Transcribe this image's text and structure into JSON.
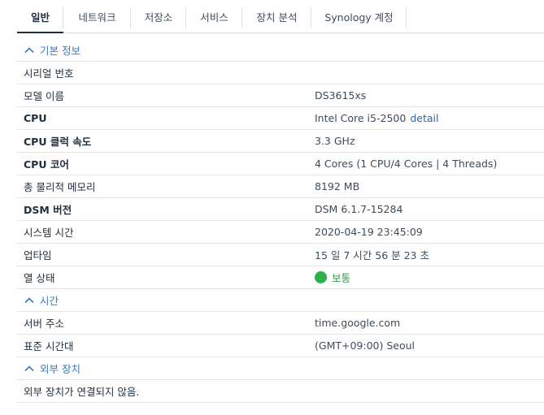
{
  "tabs": [
    {
      "label": "일반",
      "active": true
    },
    {
      "label": "네트워크"
    },
    {
      "label": "저장소"
    },
    {
      "label": "서비스"
    },
    {
      "label": "장치 분석"
    },
    {
      "label": "Synology 계정"
    }
  ],
  "sections": {
    "basic": {
      "title": "기본 정보",
      "rows": [
        {
          "label": "시리얼 번호",
          "value": ""
        },
        {
          "label": "모델 이름",
          "value": "DS3615xs"
        },
        {
          "label": "CPU",
          "value": "Intel Core i5-2500",
          "link": "detail"
        },
        {
          "label": "CPU 클럭 속도",
          "value": "3.3 GHz"
        },
        {
          "label": "CPU 코어",
          "value": "4 Cores (1 CPU/4 Cores | 4 Threads)"
        },
        {
          "label": "총 물리적 메모리",
          "value": "8192 MB"
        },
        {
          "label": "DSM 버전",
          "value": "DSM 6.1.7-15284"
        },
        {
          "label": "시스템 시간",
          "value": "2020-04-19 23:45:09"
        },
        {
          "label": "업타임",
          "value": "15 일 7 시간 56 분 23 초"
        },
        {
          "label": "열 상태",
          "value": "보통",
          "status_color": "#2bb24c"
        }
      ]
    },
    "time": {
      "title": "시간",
      "rows": [
        {
          "label": "서버 주소",
          "value": "time.google.com"
        },
        {
          "label": "표준 시간대",
          "value": "(GMT+09:00) Seoul"
        }
      ]
    },
    "external": {
      "title": "외부 장치",
      "message": "외부 장치가 연결되지 않음."
    }
  },
  "colors": {
    "accent": "#3c7ab6",
    "link": "#2c64a8",
    "status_ok": "#2bb24c",
    "text": "#1f2d3d"
  }
}
